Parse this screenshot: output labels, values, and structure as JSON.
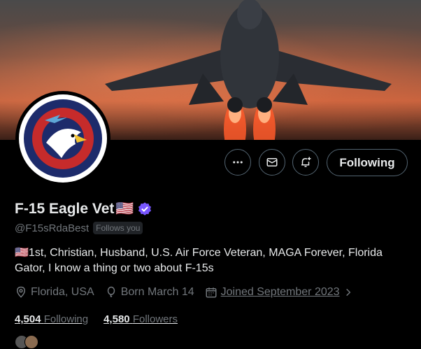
{
  "profile": {
    "name": "F-15 Eagle Vet",
    "flag": "🇺🇸",
    "handle": "@F15sRdaBest",
    "follows_you": "Follows you",
    "bio": "🇺🇸1st, Christian, Husband, U.S. Air Force Veteran, MAGA Forever, Florida Gator, I know a thing or two about F-15s",
    "location": "Florida, USA",
    "born": "Born March 14",
    "joined": "Joined September 2023",
    "following_count": "4,504",
    "following_label": "Following",
    "followers_count": "4,580",
    "followers_label": "Followers",
    "verified_color": "#7856ff"
  },
  "avatar_text": "EAGLE CREW CHIEF",
  "actions": {
    "more_icon": "more-horizontal-icon",
    "message_icon": "envelope-icon",
    "notify_icon": "bell-plus-icon",
    "following_label": "Following"
  },
  "colors": {
    "background": "#000000",
    "text_primary": "#e7e9ea",
    "text_secondary": "#71767b"
  }
}
